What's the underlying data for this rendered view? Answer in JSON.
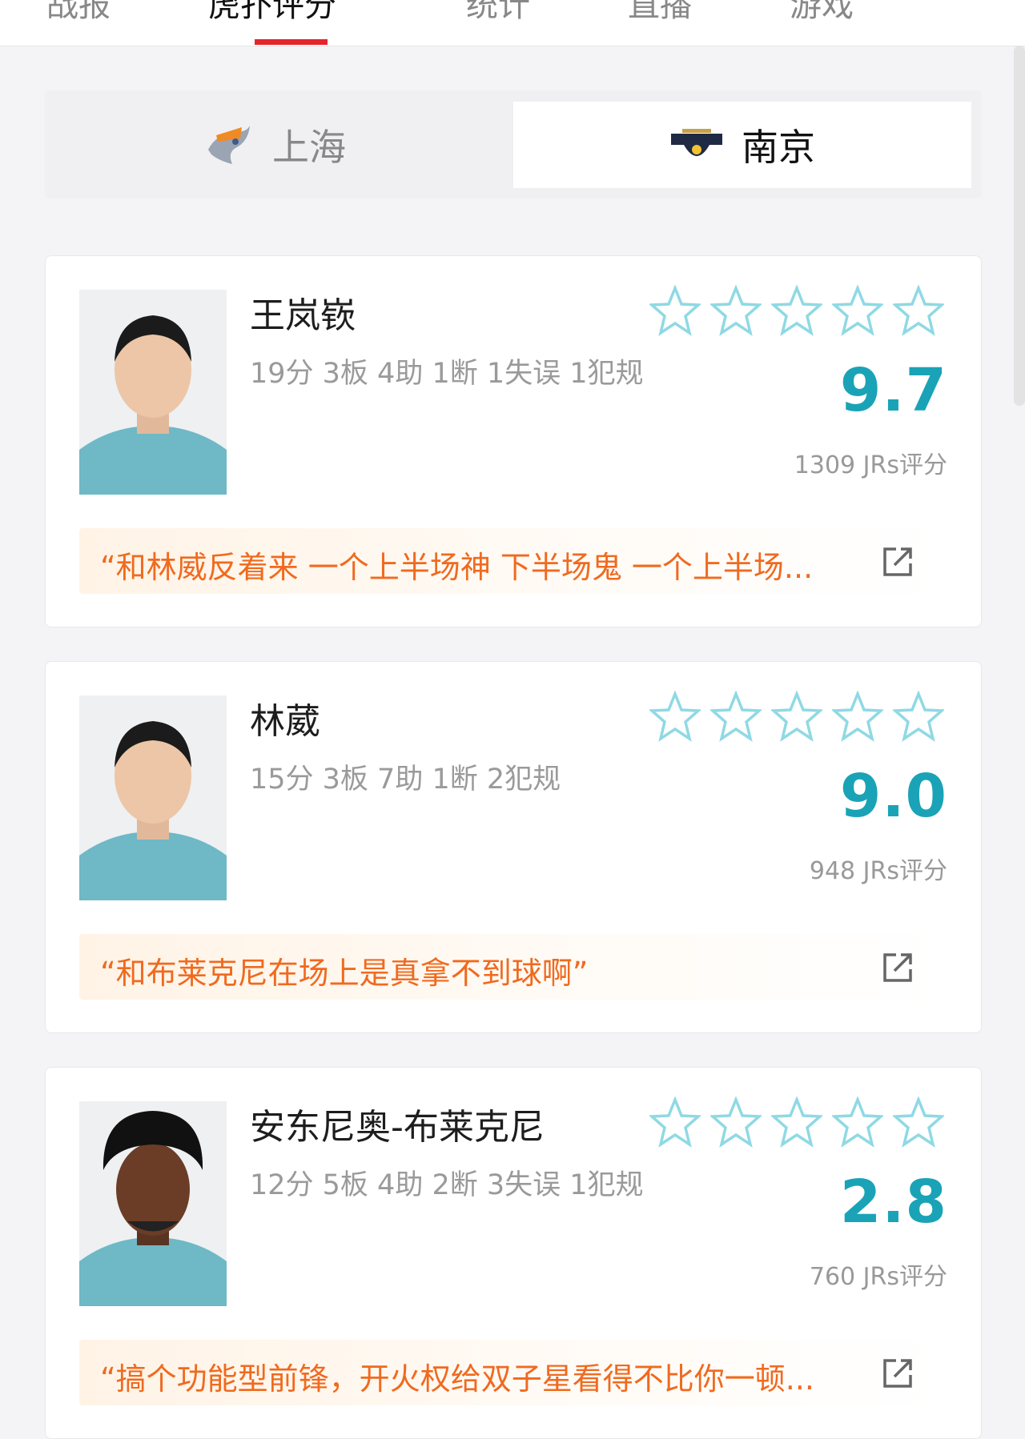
{
  "top_tabs": [
    {
      "label": "战报",
      "active": false
    },
    {
      "label": "虎扑评分",
      "active": true
    },
    {
      "label": "统计",
      "active": false
    },
    {
      "label": "直播",
      "active": false
    },
    {
      "label": "游戏",
      "active": false
    }
  ],
  "team_switch": {
    "left": {
      "name": "上海",
      "logo_icon": "sharks-logo",
      "selected": false
    },
    "right": {
      "name": "南京",
      "logo_icon": "monkey-kings-logo",
      "selected": true
    }
  },
  "colors": {
    "accent_red": "#e4252c",
    "score_teal": "#1aa3b6",
    "star_outline": "#8fd9e4",
    "quote_orange": "#f06a1f"
  },
  "players": [
    {
      "name": "王岚嵚",
      "stats": "19分 3板 4助 1断 1失误 1犯规",
      "score": "9.7",
      "votes": "1309 JRs评分",
      "quote": "“和林威反着来 一个上半场神 下半场鬼 一个上半场...",
      "stars_filled": 0,
      "stars_total": 5
    },
    {
      "name": "林葳",
      "stats": "15分 3板 7助 1断 2犯规",
      "score": "9.0",
      "votes": "948 JRs评分",
      "quote": "“和布莱克尼在场上是真拿不到球啊”",
      "stars_filled": 0,
      "stars_total": 5
    },
    {
      "name": "安东尼奥-布莱克尼",
      "stats": "12分 5板 4助 2断 3失误 1犯规",
      "score": "2.8",
      "votes": "760 JRs评分",
      "quote": "“搞个功能型前锋，开火权给双子星看得不比你一顿...",
      "stars_filled": 0,
      "stars_total": 5
    }
  ]
}
